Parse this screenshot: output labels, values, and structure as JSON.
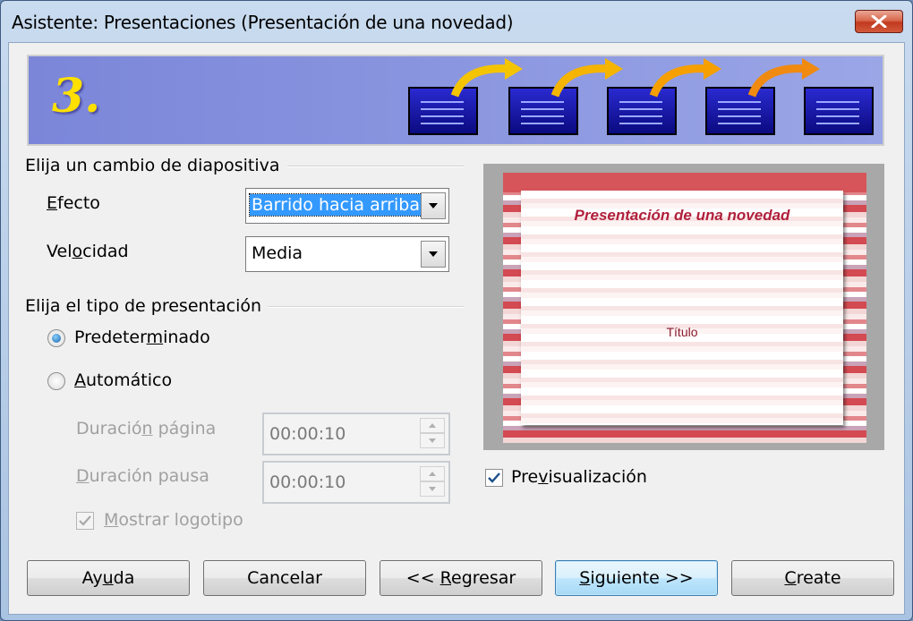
{
  "window": {
    "title": "Asistente: Presentaciones (Presentación de una novedad)"
  },
  "banner": {
    "step": "3."
  },
  "transition_group": {
    "title": "Elija un cambio de diapositiva",
    "effect_label": "Efecto",
    "effect_value": "Barrido hacia arriba",
    "speed_label": "Velocidad",
    "speed_value": "Media"
  },
  "presentation_group": {
    "title": "Elija el tipo de presentación",
    "default_label": "Predeterminado",
    "default_selected": true,
    "automatic_label": "Automático",
    "automatic_selected": false,
    "page_duration_label": "Duración página",
    "page_duration_value": "00:00:10",
    "pause_duration_label": "Duración pausa",
    "pause_duration_value": "00:00:10",
    "show_logo_label": "Mostrar logotipo",
    "show_logo_checked": true
  },
  "preview": {
    "slide_title": "Presentación de una novedad",
    "slide_subtitle": "Título",
    "checkbox_label": "Previsualización",
    "checked": true
  },
  "buttons": {
    "help": "Ayuda",
    "cancel": "Cancelar",
    "back": "<< Regresar",
    "next": "Siguiente >>",
    "create": "Create"
  }
}
